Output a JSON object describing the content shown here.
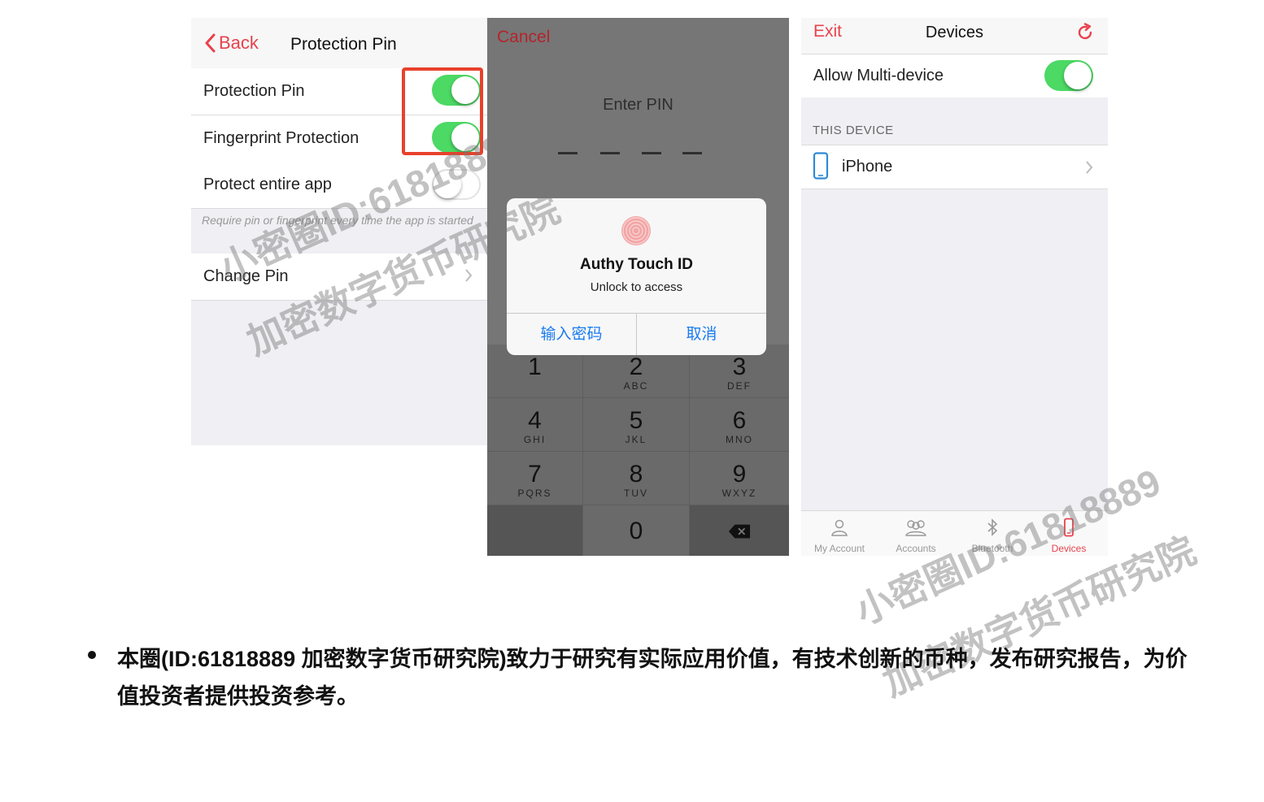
{
  "screen1": {
    "back_label": "Back",
    "title": "Protection Pin",
    "rows": [
      {
        "label": "Protection Pin",
        "toggle": "on"
      },
      {
        "label": "Fingerprint Protection",
        "toggle": "on"
      },
      {
        "label": "Protect entire app",
        "toggle": "off"
      }
    ],
    "hint": "Require pin or fingerprint every time the app is started",
    "change_pin_label": "Change Pin"
  },
  "screen2": {
    "cancel_label": "Cancel",
    "enter_pin_label": "Enter PIN",
    "alert": {
      "title": "Authy Touch ID",
      "subtitle": "Unlock to access",
      "button_left": "输入密码",
      "button_right": "取消"
    },
    "keys": [
      {
        "num": "1",
        "letters": ""
      },
      {
        "num": "2",
        "letters": "ABC"
      },
      {
        "num": "3",
        "letters": "DEF"
      },
      {
        "num": "4",
        "letters": "GHI"
      },
      {
        "num": "5",
        "letters": "JKL"
      },
      {
        "num": "6",
        "letters": "MNO"
      },
      {
        "num": "7",
        "letters": "PQRS"
      },
      {
        "num": "8",
        "letters": "TUV"
      },
      {
        "num": "9",
        "letters": "WXYZ"
      },
      {
        "num": "0",
        "letters": ""
      }
    ]
  },
  "screen3": {
    "exit_label": "Exit",
    "title": "Devices",
    "allow_multi_label": "Allow Multi-device",
    "allow_multi_toggle": "on",
    "section_header": "THIS DEVICE",
    "device_name": "iPhone",
    "tabs": [
      {
        "label": "My Account",
        "icon": "person-icon",
        "active": false
      },
      {
        "label": "Accounts",
        "icon": "people-icon",
        "active": false
      },
      {
        "label": "Bluetooth",
        "icon": "bluetooth-icon",
        "active": false
      },
      {
        "label": "Devices",
        "icon": "phone-icon",
        "active": true
      }
    ]
  },
  "watermark": {
    "line1": "小密圈ID:61818889",
    "line2": "加密数字货币研究院"
  },
  "caption": "本圈(ID:61818889 加密数字货币研究院)致力于研究有实际应用价值，有技术创新的币种，发布研究报告，为价值投资者提供投资参考。",
  "colors": {
    "accent_red": "#e8424c",
    "toggle_green": "#4cd964",
    "ios_blue": "#1a7cf0",
    "highlight_box": "#e8412c"
  }
}
